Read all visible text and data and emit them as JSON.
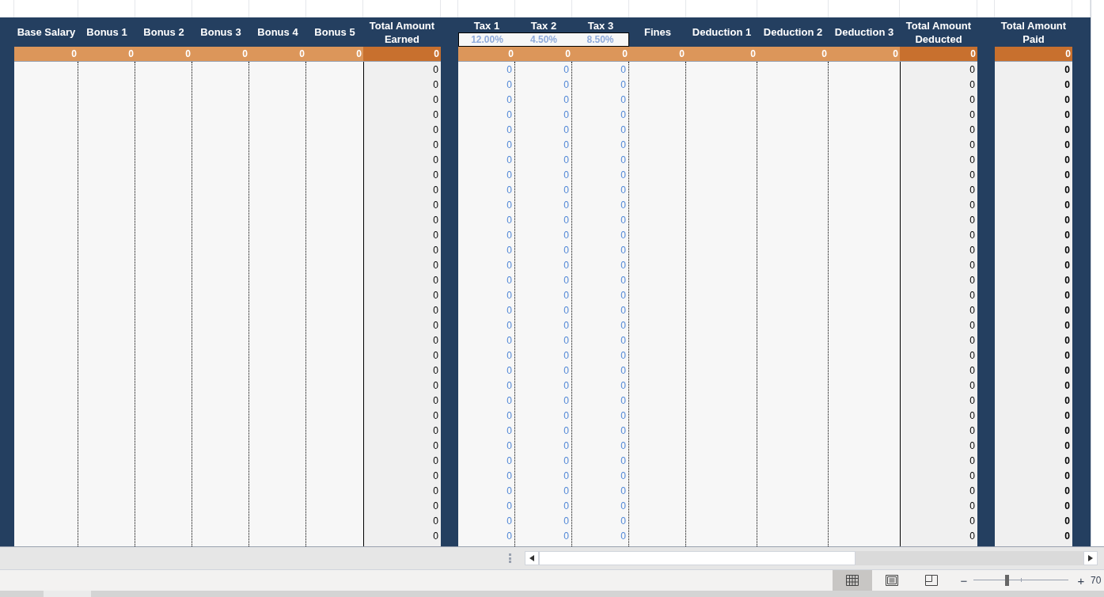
{
  "sections": [
    {
      "columns": [
        {
          "kind": "entry",
          "label": "Base Salary",
          "total": "0"
        },
        {
          "kind": "entry",
          "label": "Bonus 1",
          "total": "0"
        },
        {
          "kind": "entry",
          "label": "Bonus 2",
          "total": "0"
        },
        {
          "kind": "entry",
          "label": "Bonus 3",
          "total": "0"
        },
        {
          "kind": "entry",
          "label": "Bonus 4",
          "total": "0"
        },
        {
          "kind": "entry",
          "label": "Bonus 5",
          "total": "0"
        },
        {
          "kind": "total",
          "label": "Total Amount Earned",
          "total": "0",
          "values": [
            "0",
            "0",
            "0",
            "0",
            "0",
            "0",
            "0",
            "0",
            "0",
            "0",
            "0",
            "0",
            "0",
            "0",
            "0",
            "0",
            "0",
            "0",
            "0",
            "0",
            "0",
            "0",
            "0",
            "0",
            "0",
            "0",
            "0",
            "0",
            "0",
            "0",
            "0",
            "0"
          ]
        }
      ]
    },
    {
      "columns": [
        {
          "kind": "tax",
          "label": "Tax 1",
          "rate": "12.00%",
          "total": "0",
          "values": [
            "0",
            "0",
            "0",
            "0",
            "0",
            "0",
            "0",
            "0",
            "0",
            "0",
            "0",
            "0",
            "0",
            "0",
            "0",
            "0",
            "0",
            "0",
            "0",
            "0",
            "0",
            "0",
            "0",
            "0",
            "0",
            "0",
            "0",
            "0",
            "0",
            "0",
            "0",
            "0"
          ]
        },
        {
          "kind": "tax",
          "label": "Tax 2",
          "rate": "4.50%",
          "total": "0",
          "values": [
            "0",
            "0",
            "0",
            "0",
            "0",
            "0",
            "0",
            "0",
            "0",
            "0",
            "0",
            "0",
            "0",
            "0",
            "0",
            "0",
            "0",
            "0",
            "0",
            "0",
            "0",
            "0",
            "0",
            "0",
            "0",
            "0",
            "0",
            "0",
            "0",
            "0",
            "0",
            "0"
          ]
        },
        {
          "kind": "tax",
          "label": "Tax 3",
          "rate": "8.50%",
          "total": "0",
          "values": [
            "0",
            "0",
            "0",
            "0",
            "0",
            "0",
            "0",
            "0",
            "0",
            "0",
            "0",
            "0",
            "0",
            "0",
            "0",
            "0",
            "0",
            "0",
            "0",
            "0",
            "0",
            "0",
            "0",
            "0",
            "0",
            "0",
            "0",
            "0",
            "0",
            "0",
            "0",
            "0"
          ]
        },
        {
          "kind": "entry",
          "label": "Fines",
          "total": "0"
        },
        {
          "kind": "entry",
          "label": "Deduction 1",
          "total": "0"
        },
        {
          "kind": "entry",
          "label": "Deduction 2",
          "total": "0"
        },
        {
          "kind": "entry",
          "label": "Deduction 3",
          "total": "0"
        },
        {
          "kind": "total",
          "label": "Total Amount Deducted",
          "total": "0",
          "values": [
            "0",
            "0",
            "0",
            "0",
            "0",
            "0",
            "0",
            "0",
            "0",
            "0",
            "0",
            "0",
            "0",
            "0",
            "0",
            "0",
            "0",
            "0",
            "0",
            "0",
            "0",
            "0",
            "0",
            "0",
            "0",
            "0",
            "0",
            "0",
            "0",
            "0",
            "0",
            "0"
          ]
        }
      ]
    },
    {
      "columns": [
        {
          "kind": "grand",
          "label": "Total Amount Paid",
          "total": "0",
          "values": [
            "0",
            "0",
            "0",
            "0",
            "0",
            "0",
            "0",
            "0",
            "0",
            "0",
            "0",
            "0",
            "0",
            "0",
            "0",
            "0",
            "0",
            "0",
            "0",
            "0",
            "0",
            "0",
            "0",
            "0",
            "0",
            "0",
            "0",
            "0",
            "0",
            "0",
            "0",
            "0"
          ]
        }
      ]
    }
  ],
  "status_bar": {
    "views": [
      {
        "kind": "normal",
        "selected": true
      },
      {
        "kind": "page-layout",
        "selected": false
      },
      {
        "kind": "page-break",
        "selected": false
      }
    ],
    "zoom": {
      "minus": "−",
      "plus": "+",
      "level": 0.35,
      "reading": "70"
    }
  }
}
